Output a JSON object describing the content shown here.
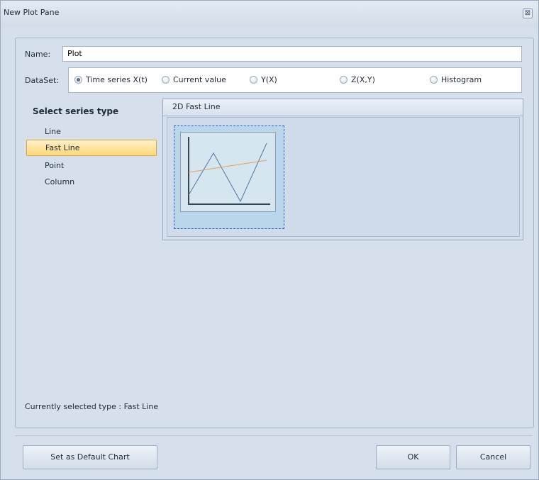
{
  "window": {
    "title": "New Plot Pane",
    "close_glyph": "⊠"
  },
  "name_field": {
    "label": "Name:",
    "value": "Plot"
  },
  "dataset": {
    "label": "DataSet:",
    "options": [
      {
        "label": "Time series X(t)",
        "checked": true
      },
      {
        "label": "Current value",
        "checked": false
      },
      {
        "label": "Y(X)",
        "checked": false
      },
      {
        "label": "Z(X,Y)",
        "checked": false
      },
      {
        "label": "Histogram",
        "checked": false
      }
    ]
  },
  "series_list": {
    "title": "Select series type",
    "items": [
      {
        "label": "Line",
        "selected": false
      },
      {
        "label": "Fast Line",
        "selected": true
      },
      {
        "label": "Point",
        "selected": false
      },
      {
        "label": "Column",
        "selected": false
      }
    ]
  },
  "preview_panel": {
    "header": "2D Fast Line",
    "colors": {
      "series_blue": "#5c7fa6",
      "series_orange": "#e3a25a",
      "axis": "#3a4350"
    }
  },
  "status": {
    "text": "Currently selected type : Fast Line"
  },
  "buttons": {
    "set_default": "Set as Default Chart",
    "ok": "OK",
    "cancel": "Cancel"
  }
}
